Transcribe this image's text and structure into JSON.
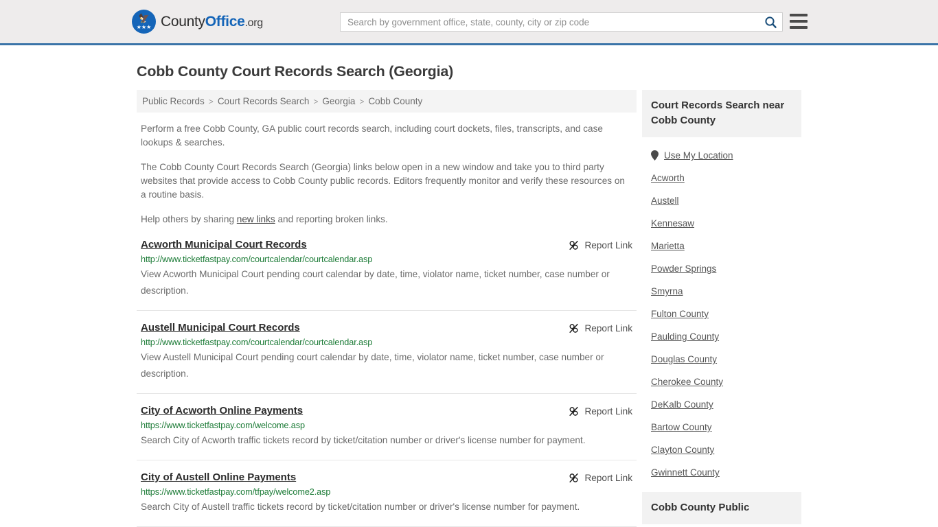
{
  "header": {
    "brand": {
      "part1": "County",
      "part2": "Office",
      "tld": ".org",
      "logo_icon": "eagle-shield-icon"
    },
    "search": {
      "placeholder": "Search by government office, state, county, city or zip code",
      "value": "",
      "icon": "search-icon"
    },
    "menu_icon": "hamburger-menu-icon",
    "accent_color": "#3b74a8",
    "background_color": "#eeecec"
  },
  "page": {
    "title": "Cobb County Court Records Search (Georgia)"
  },
  "breadcrumb": {
    "items": [
      {
        "label": "Public Records"
      },
      {
        "label": "Court Records Search"
      },
      {
        "label": "Georgia"
      },
      {
        "label": "Cobb County"
      }
    ],
    "separator": ">"
  },
  "intro": {
    "paragraph1": "Perform a free Cobb County, GA public court records search, including court dockets, files, transcripts, and case lookups & searches.",
    "paragraph2": "The Cobb County Court Records Search (Georgia) links below open in a new window and take you to third party websites that provide access to Cobb County public records. Editors frequently monitor and verify these resources on a routine basis.",
    "paragraph3_pre": "Help others by sharing ",
    "paragraph3_link": "new links",
    "paragraph3_post": " and reporting broken links."
  },
  "results": {
    "report_label": "Report Link",
    "report_icon": "broken-link-icon",
    "items": [
      {
        "title": "Acworth Municipal Court Records",
        "url": "http://www.ticketfastpay.com/courtcalendar/courtcalendar.asp",
        "description": "View Acworth Municipal Court pending court calendar by date, time, violator name, ticket number, case number or description."
      },
      {
        "title": "Austell Municipal Court Records",
        "url": "http://www.ticketfastpay.com/courtcalendar/courtcalendar.asp",
        "description": "View Austell Municipal Court pending court calendar by date, time, violator name, ticket number, case number or description."
      },
      {
        "title": "City of Acworth Online Payments",
        "url": "https://www.ticketfastpay.com/welcome.asp",
        "description": "Search City of Acworth traffic tickets record by ticket/citation number or driver's license number for payment."
      },
      {
        "title": "City of Austell Online Payments",
        "url": "https://www.ticketfastpay.com/tfpay/welcome2.asp",
        "description": "Search City of Austell traffic tickets record by ticket/citation number or driver's license number for payment."
      }
    ]
  },
  "sidebar": {
    "card1_heading": "Court Records Search near Cobb County",
    "use_my_location": {
      "label": "Use My Location",
      "icon": "map-pin-icon"
    },
    "links": [
      {
        "label": "Acworth"
      },
      {
        "label": "Austell"
      },
      {
        "label": "Kennesaw"
      },
      {
        "label": "Marietta"
      },
      {
        "label": "Powder Springs"
      },
      {
        "label": "Smyrna"
      },
      {
        "label": "Fulton County"
      },
      {
        "label": "Paulding County"
      },
      {
        "label": "Douglas County"
      },
      {
        "label": "Cherokee County"
      },
      {
        "label": "DeKalb County"
      },
      {
        "label": "Bartow County"
      },
      {
        "label": "Clayton County"
      },
      {
        "label": "Gwinnett County"
      }
    ],
    "card2_heading": "Cobb County Public"
  },
  "colors": {
    "url_green": "#1a7a35",
    "link_gray": "#555555",
    "text_gray": "#6a6a6a",
    "brand_blue": "#1565b8"
  }
}
